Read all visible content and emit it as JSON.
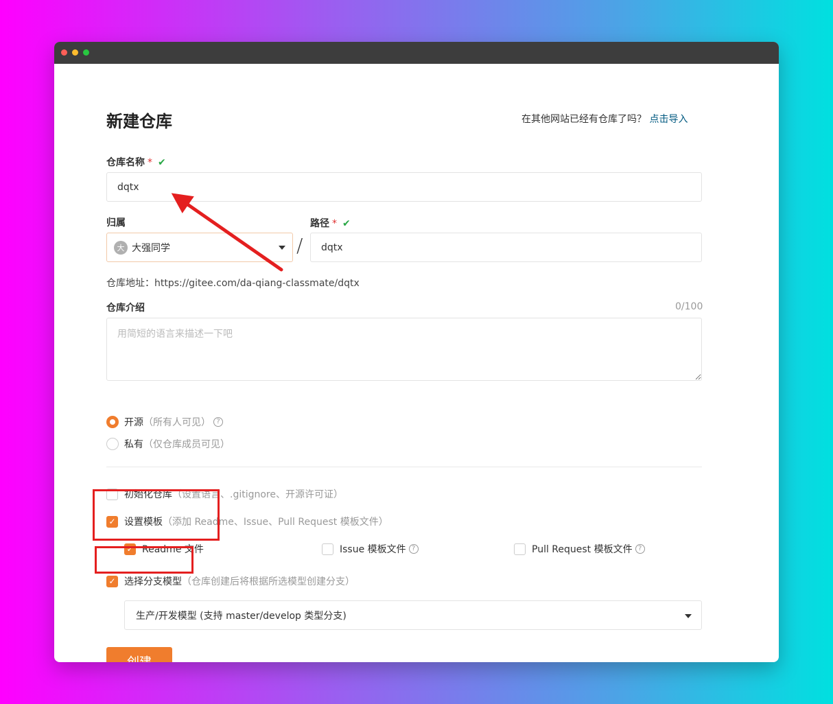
{
  "page": {
    "title": "新建仓库",
    "import_prompt": "在其他网站已经有仓库了吗？",
    "import_link": "点击导入"
  },
  "repo_name": {
    "label": "仓库名称",
    "required_mark": "*",
    "valid_mark": "✔",
    "value": "dqtx"
  },
  "owner": {
    "label": "归属",
    "avatar_text": "大",
    "value": "大强同学"
  },
  "path": {
    "label": "路径",
    "required_mark": "*",
    "valid_mark": "✔",
    "separator": "/",
    "value": "dqtx"
  },
  "repo_address": "仓库地址：https://gitee.com/da-qiang-classmate/dqtx",
  "description": {
    "label": "仓库介绍",
    "counter": "0/100",
    "placeholder": "用简短的语言来描述一下吧"
  },
  "visibility": {
    "public_label": "开源",
    "public_note": "（所有人可见）",
    "private_label": "私有",
    "private_note": "（仅仓库成员可见）",
    "selected": "public"
  },
  "init_repo": {
    "label": "初始化仓库",
    "note": "（设置语言、.gitignore、开源许可证）",
    "checked": false
  },
  "templates": {
    "label": "设置模板",
    "note": "（添加 Readme、Issue、Pull Request 模板文件）",
    "checked": true,
    "readme_label": "Readme 文件",
    "readme_checked": true,
    "issue_label": "Issue 模板文件",
    "issue_checked": false,
    "pr_label": "Pull Request 模板文件",
    "pr_checked": false
  },
  "branch_model": {
    "label": "选择分支模型",
    "note": "（仓库创建后将根据所选模型创建分支）",
    "checked": true,
    "selected": "生产/开发模型 (支持 master/develop 类型分支)"
  },
  "create_button": "创建",
  "colors": {
    "accent": "#f07d2d",
    "link": "#005980",
    "valid": "#28a745",
    "required": "#e03131",
    "annotation": "#e41f1f"
  }
}
